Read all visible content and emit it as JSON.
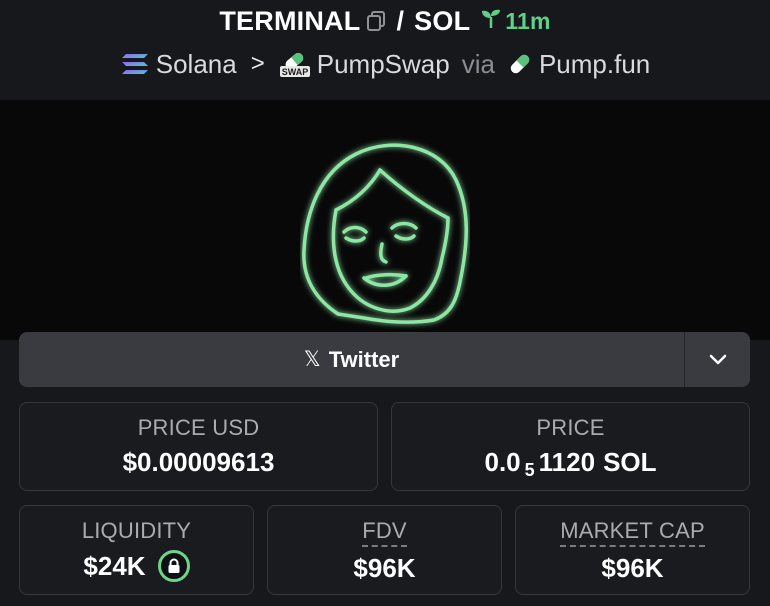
{
  "header": {
    "token_symbol": "TERMINAL",
    "separator": "/",
    "quote_symbol": "SOL",
    "age": "11m"
  },
  "breadcrumb": {
    "chain": "Solana",
    "arrow": ">",
    "dex": "PumpSwap",
    "via": "via",
    "launchpad": "Pump.fun",
    "dex_badge": "SWAP"
  },
  "socials": {
    "twitter_label": "Twitter",
    "x_glyph": "𝕏"
  },
  "stats": {
    "price_usd_label": "PRICE USD",
    "price_usd_value": "$0.00009613",
    "price_label": "PRICE",
    "price_prefix": "0.0",
    "price_zeros": "5",
    "price_digits": "1120",
    "price_unit": "SOL",
    "liquidity_label": "LIQUIDITY",
    "liquidity_value": "$24K",
    "fdv_label": "FDV",
    "fdv_value": "$96K",
    "mcap_label": "MARKET CAP",
    "mcap_value": "$96K"
  },
  "colors": {
    "accent_green": "#5fd08a",
    "background": "#17181c",
    "card_border": "#35363b"
  }
}
